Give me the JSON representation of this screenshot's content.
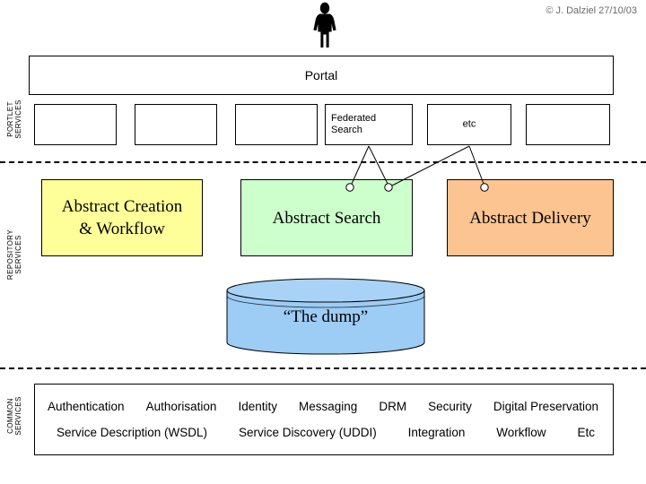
{
  "copyright": "© J. Dalziel 27/10/03",
  "icons": {
    "user_figure": "user-silhouette-icon"
  },
  "portal": {
    "label": "Portal"
  },
  "bands": [
    {
      "id": "portlet",
      "label": "PORTLET\nSERVICES"
    },
    {
      "id": "repository",
      "label": "REPOSITORY\nSERVICES"
    },
    {
      "id": "common",
      "label": "COMMON\nSERVICES"
    }
  ],
  "portlets": [
    {
      "label": "",
      "align": "center"
    },
    {
      "label": "",
      "align": "center"
    },
    {
      "label": "",
      "align": "center"
    },
    {
      "label": "Federated\nSearch",
      "align": "left"
    },
    {
      "label": "etc",
      "align": "center"
    },
    {
      "label": "",
      "align": "center"
    }
  ],
  "abstract_services": [
    {
      "id": "creation",
      "label": "Abstract Creation\n& Workflow",
      "color": "#FFFF99"
    },
    {
      "id": "search",
      "label": "Abstract Search",
      "color": "#CCFFCC"
    },
    {
      "id": "delivery",
      "label": "Abstract Delivery",
      "color": "#FBC490"
    }
  ],
  "datastore": {
    "label": "“The dump”",
    "color": "#9DCCF5"
  },
  "common_services": {
    "row_1": [
      "Authentication",
      "Authorisation",
      "Identity",
      "Messaging",
      "DRM",
      "Security",
      "Digital Preservation"
    ],
    "row_2": [
      "Service Description (WSDL)",
      "Service Discovery (UDDI)",
      "Integration",
      "Workflow",
      "Etc"
    ]
  },
  "colors": {
    "stroke": "#000000",
    "background": "#FFFFFF",
    "copyright_text": "#6B6B6B"
  }
}
